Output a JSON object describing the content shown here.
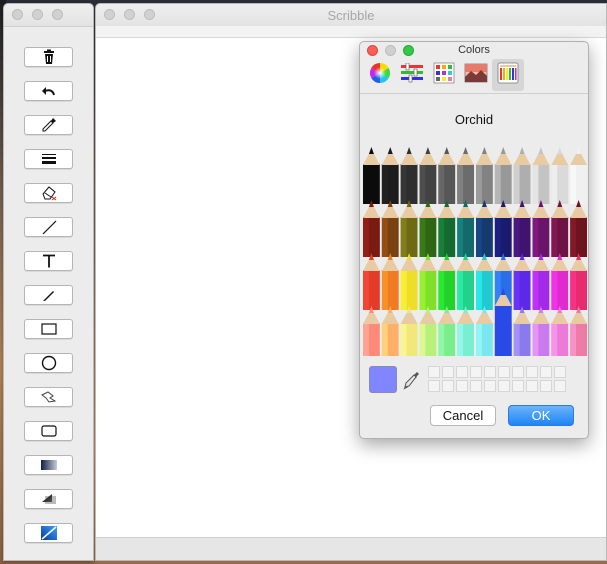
{
  "main_window": {
    "title": "Scribble"
  },
  "tools": [
    {
      "name": "delete-tool",
      "icon": "trash-icon"
    },
    {
      "name": "undo-tool",
      "icon": "undo-icon"
    },
    {
      "name": "eyedropper-tool",
      "icon": "eyedropper-icon"
    },
    {
      "name": "line-width-tool",
      "icon": "line-width-icon"
    },
    {
      "name": "eraser-tool",
      "icon": "eraser-icon"
    },
    {
      "name": "line-tool",
      "icon": "line-icon"
    },
    {
      "name": "text-tool",
      "icon": "text-icon",
      "label": "T"
    },
    {
      "name": "pencil-tool",
      "icon": "pencil-icon"
    },
    {
      "name": "rectangle-tool",
      "icon": "rectangle-icon"
    },
    {
      "name": "oval-tool",
      "icon": "oval-icon"
    },
    {
      "name": "freeform-tool",
      "icon": "freeform-icon"
    },
    {
      "name": "rounded-rect-tool",
      "icon": "rounded-rectangle-icon"
    },
    {
      "name": "gradient-tool",
      "icon": "gradient-icon"
    },
    {
      "name": "shadow-tool",
      "icon": "shadow-icon"
    },
    {
      "name": "fill-tool",
      "icon": "fill-icon"
    }
  ],
  "colors_panel": {
    "title": "Colors",
    "selected_color_name": "Orchid",
    "selected_color": "#7f86ff",
    "tabs": [
      {
        "name": "color-wheel",
        "icon": "color-wheel-icon",
        "selected": false
      },
      {
        "name": "color-sliders",
        "icon": "color-sliders-icon",
        "selected": false
      },
      {
        "name": "color-palettes",
        "icon": "color-palettes-icon",
        "selected": false
      },
      {
        "name": "image-palettes",
        "icon": "image-palettes-icon",
        "selected": false
      },
      {
        "name": "pencils",
        "icon": "pencils-icon",
        "selected": true
      }
    ],
    "cancel_label": "Cancel",
    "ok_label": "OK",
    "pencil_rows": [
      [
        "#0b0b0b",
        "#1c1c1c",
        "#2e2e2e",
        "#424242",
        "#575757",
        "#6c6c6c",
        "#828282",
        "#989898",
        "#aeaeae",
        "#c4c4c4",
        "#dadada",
        "#f0f0f0"
      ],
      [
        "#7a1a12",
        "#7a4212",
        "#6e6a14",
        "#2f6614",
        "#146a30",
        "#146a6a",
        "#143a6e",
        "#1a1a6e",
        "#3e146e",
        "#6a146a",
        "#6e1444",
        "#6e1420"
      ],
      [
        "#e33b2a",
        "#f07b22",
        "#eede2a",
        "#7fe02a",
        "#22d12a",
        "#22d18a",
        "#22c9d1",
        "#2a6ee8",
        "#5a2ae8",
        "#a22ae8",
        "#e02ad0",
        "#e82a6e"
      ],
      [
        "#ff8a7a",
        "#ffb066",
        "#f2e87a",
        "#b8f07a",
        "#7aee8a",
        "#7aeed0",
        "#7ae6ee",
        "#4a7aee",
        "#8a7aee",
        "#c87aee",
        "#ee7ad8",
        "#ee7aa6"
      ]
    ]
  }
}
